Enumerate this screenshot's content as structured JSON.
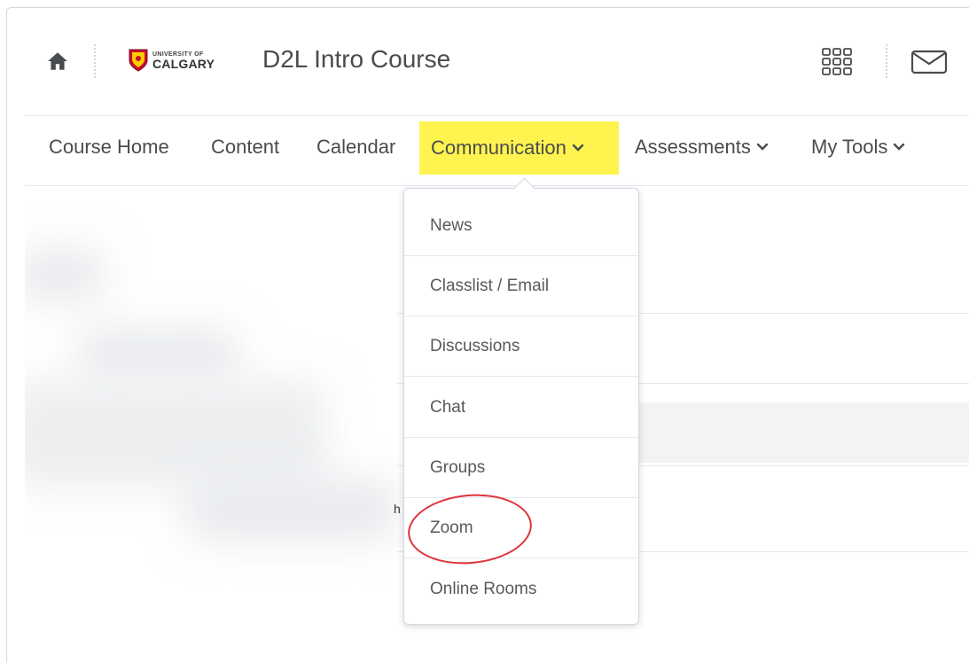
{
  "header": {
    "logo_line1": "UNIVERSITY OF",
    "logo_line2": "CALGARY",
    "course_title": "D2L Intro Course"
  },
  "nav": {
    "items": [
      {
        "label": "Course Home"
      },
      {
        "label": "Content"
      },
      {
        "label": "Calendar"
      },
      {
        "label": "Communication",
        "highlighted": true,
        "has_dropdown": true
      },
      {
        "label": "Assessments",
        "has_dropdown": true
      },
      {
        "label": "My Tools",
        "has_dropdown": true
      }
    ]
  },
  "dropdown": {
    "items": [
      {
        "label": "News"
      },
      {
        "label": "Classlist / Email"
      },
      {
        "label": "Discussions"
      },
      {
        "label": "Chat"
      },
      {
        "label": "Groups"
      },
      {
        "label": "Zoom",
        "annotated": true
      },
      {
        "label": "Online Rooms"
      }
    ]
  },
  "background": {
    "stray_text": "h"
  },
  "colors": {
    "highlight": "#fff44f",
    "annotation": "#e0323a",
    "text": "#494c4e",
    "border": "#d3d9e3"
  },
  "icons": {
    "home": "home-icon",
    "apps": "waffle-grid-icon",
    "mail": "envelope-icon",
    "chevron": "chevron-down-icon",
    "logo": "university-crest-logo"
  }
}
